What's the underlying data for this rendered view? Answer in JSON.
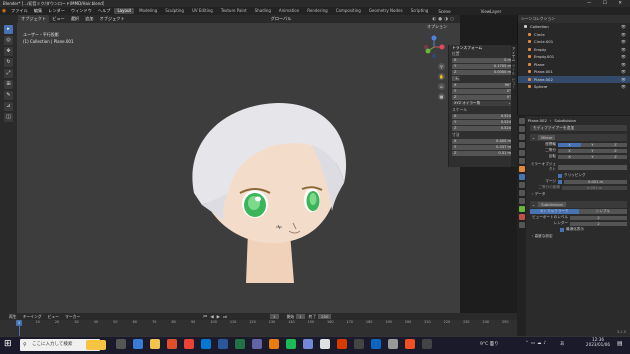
{
  "title_bar": {
    "text": "Blender* [.../初音ミク/ダウンロード/MMD/Hair.blend]"
  },
  "menus": [
    "ファイル",
    "編集",
    "レンダー",
    "ウィンドウ",
    "ヘルプ"
  ],
  "workspace_tabs": [
    "Layout",
    "Modeling",
    "Sculpting",
    "UV Editing",
    "Texture Paint",
    "Shading",
    "Animation",
    "Rendering",
    "Compositing",
    "Geometry Nodes",
    "Scripting"
  ],
  "scene": {
    "name": "Scene",
    "view_layer": "ViewLayer"
  },
  "viewport": {
    "mode": "オブジェクト",
    "menus": [
      "ビュー",
      "選択",
      "追加",
      "オブジェクト"
    ],
    "view_name": "ユーザー・平行投影",
    "collection": "(1) Collection | Plane.001",
    "transform_mode": "グローバル",
    "options_label": "オプション"
  },
  "npanel": {
    "title": "トランスフォーム",
    "location_label": "位置",
    "rotation_label": "回転",
    "scale_label": "スケール",
    "dims_label": "寸法",
    "location": [
      {
        "axis": "X",
        "value": "0 m"
      },
      {
        "axis": "Y",
        "value": "0.1705 m"
      },
      {
        "axis": "Z",
        "value": "0.0000 m"
      }
    ],
    "rotation": [
      {
        "axis": "X",
        "value": "90°"
      },
      {
        "axis": "Y",
        "value": "0°"
      },
      {
        "axis": "Z",
        "value": "0°"
      }
    ],
    "rotation_mode": "XYZ オイラー角",
    "scale": [
      {
        "axis": "X",
        "value": "0.524"
      },
      {
        "axis": "Y",
        "value": "0.524"
      },
      {
        "axis": "Z",
        "value": "0.524"
      }
    ],
    "dimensions": [
      {
        "axis": "X",
        "value": "0.400 m"
      },
      {
        "axis": "Y",
        "value": "0.337 m"
      },
      {
        "axis": "Z",
        "value": "0.31 m"
      }
    ]
  },
  "side_tabs": [
    "アイテム",
    "ツール",
    "ビュー"
  ],
  "outliner": {
    "header": "シーンコレクション",
    "items": [
      "Collection",
      "Circle",
      "Circle.001",
      "Empty",
      "Empty.001",
      "Plane",
      "Plane.001",
      "Plane.002",
      "Sphere"
    ]
  },
  "properties": {
    "object": "Plane.002",
    "modifier": "Subdivision",
    "add_modifier": "モディファイアーを追加",
    "mirror": {
      "name": "Mirror",
      "axis_label": "座標軸",
      "bisect_label": "二等分",
      "flip_label": "反転",
      "axes": [
        "X",
        "Y",
        "Z"
      ],
      "mirror_obj_label": "ミラーオブジェクト",
      "clipping_label": "クリッピング",
      "merge_label": "マージ",
      "merge_value": "0.001 m",
      "bisect_dist_label": "二等分の距離",
      "bisect_dist_value": "0.001 m",
      "data_label": "データ"
    },
    "subdiv": {
      "name": "Subdivision",
      "catmull": "カトマルクラーク",
      "simple": "シンプル",
      "levels_viewport_label": "ビューポートのレベル",
      "levels_viewport": "2",
      "render_label": "レンダー",
      "render": "2",
      "optimal_label": "最適化表示",
      "advanced_label": "高度な設定"
    }
  },
  "timeline": {
    "menus": [
      "再生",
      "キーイング",
      "ビュー",
      "マーカー"
    ],
    "current_frame": "1",
    "start_label": "開始",
    "start": "1",
    "end_label": "終了",
    "end": "250",
    "ticks": [
      "0",
      "10",
      "20",
      "30",
      "40",
      "50",
      "60",
      "70",
      "80",
      "90",
      "100",
      "110",
      "120",
      "130",
      "140",
      "150",
      "160",
      "170",
      "180",
      "190",
      "200",
      "210",
      "220",
      "230",
      "240",
      "250"
    ]
  },
  "status_bar": {
    "version": "3.1.0"
  },
  "taskbar": {
    "search_placeholder": "ここに入力して検索",
    "weather": "9°C 曇り",
    "ime": "あ",
    "time": "12:36",
    "date": "2023/01/06"
  },
  "colors": {
    "accent": "#4772b3",
    "skin": "#f2d9c7",
    "hair": "#e6e6ea",
    "eye": "#3cb55a",
    "viewport_bg": "#3d3d3d"
  }
}
